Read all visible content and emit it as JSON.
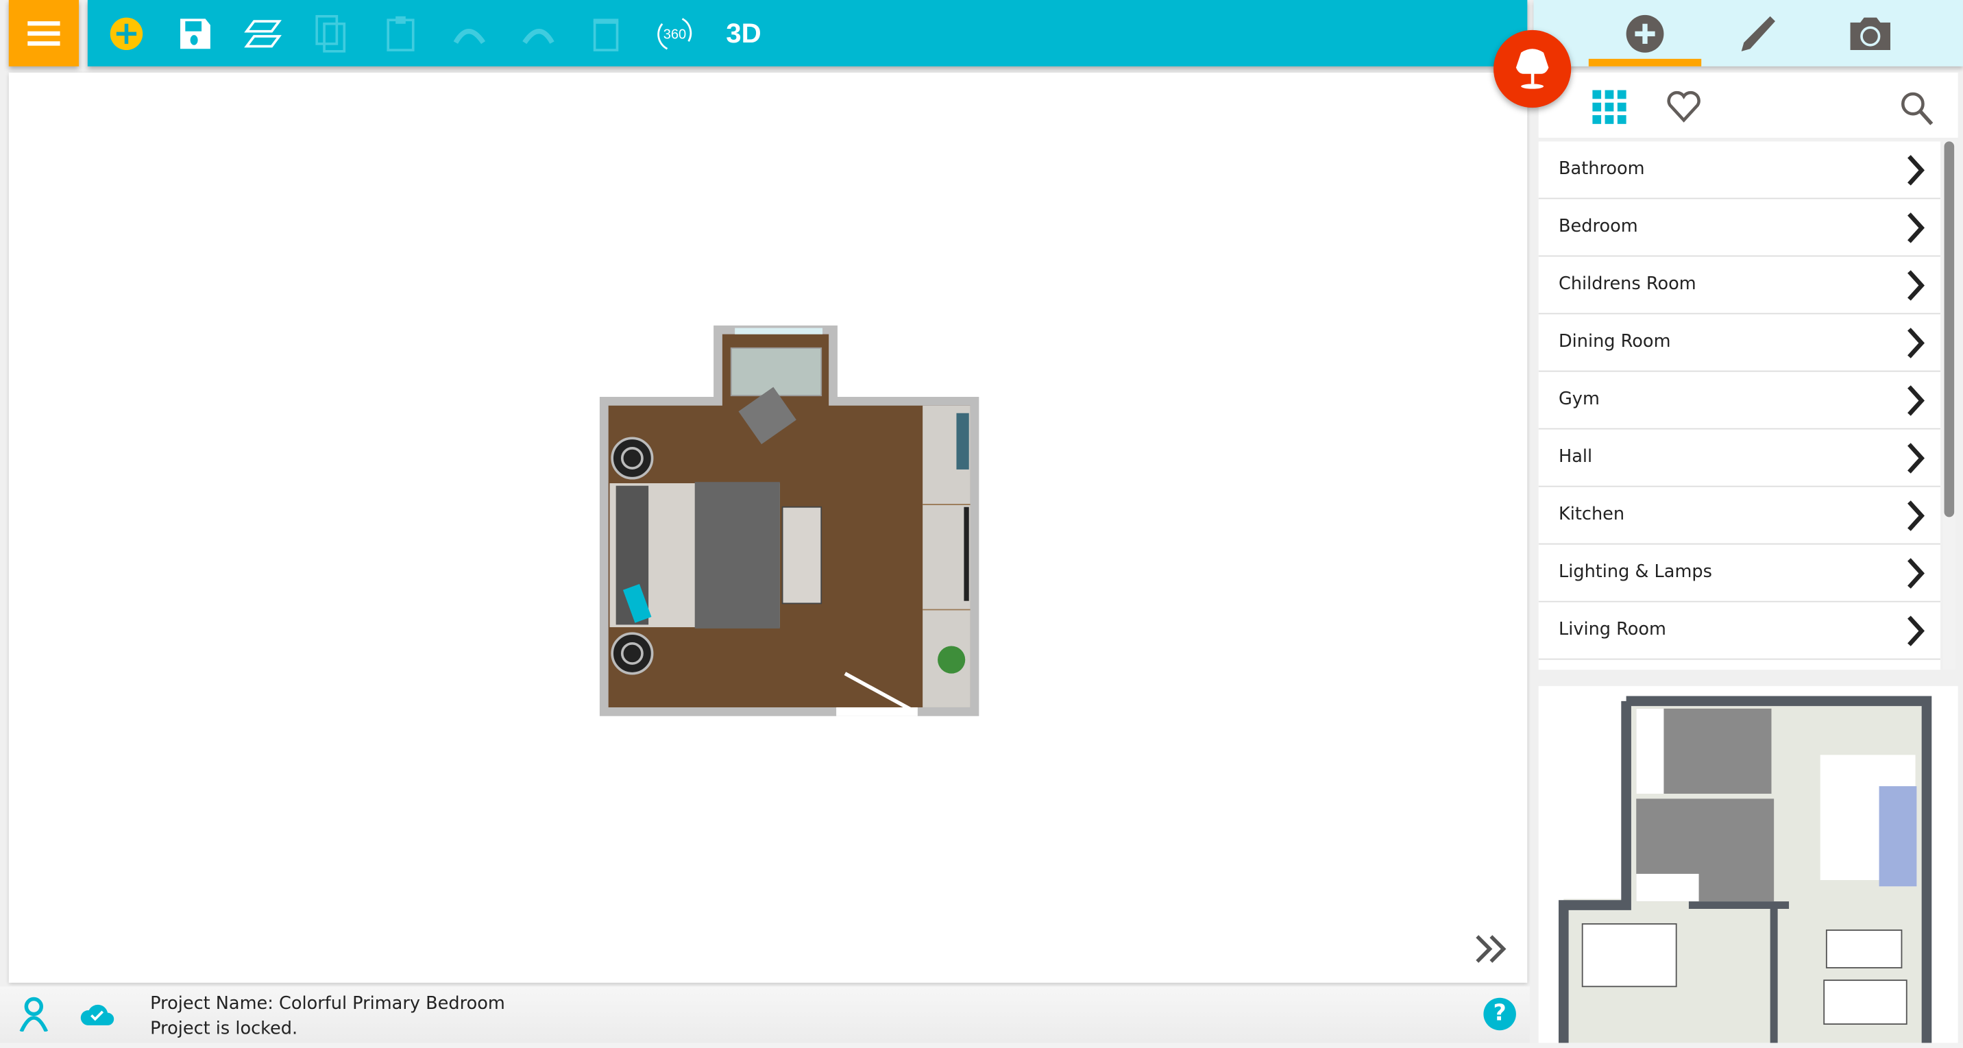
{
  "toolbar": {
    "menu_icon": "hamburger-icon",
    "tools": [
      {
        "name": "add",
        "icon": "plus-circle-icon",
        "enabled": true
      },
      {
        "name": "save",
        "icon": "save-icon",
        "enabled": true
      },
      {
        "name": "floors",
        "icon": "layers-icon",
        "enabled": true
      },
      {
        "name": "copy",
        "icon": "copy-icon",
        "enabled": false
      },
      {
        "name": "paste",
        "icon": "clipboard-icon",
        "enabled": false
      },
      {
        "name": "undo",
        "icon": "undo-icon",
        "enabled": false
      },
      {
        "name": "redo",
        "icon": "redo-icon",
        "enabled": false
      },
      {
        "name": "delete",
        "icon": "trash-icon",
        "enabled": false
      },
      {
        "name": "360",
        "icon": "rotate-360-icon",
        "enabled": true,
        "label": "360"
      },
      {
        "name": "3d",
        "icon": "3d-icon",
        "enabled": true,
        "label": "3D"
      }
    ],
    "color": "#00b8d1",
    "menu_color": "#ffa400"
  },
  "right_panel": {
    "tabs": [
      {
        "icon": "plus-circle-icon",
        "active": true
      },
      {
        "icon": "pencil-icon",
        "active": false
      },
      {
        "icon": "camera-icon",
        "active": false
      }
    ],
    "furniture_button_icon": "chair-icon",
    "subbar": {
      "grid_icon": "grid-icon",
      "favorites_icon": "heart-icon",
      "search_icon": "search-icon"
    },
    "categories": [
      "Bathroom",
      "Bedroom",
      "Childrens Room",
      "Dining Room",
      "Gym",
      "Hall",
      "Kitchen",
      "Lighting & Lamps",
      "Living Room"
    ],
    "accent": "#ffa400",
    "furniture_color": "#ee3300"
  },
  "footer": {
    "project_name": "Project Name: Colorful Primary Bedroom",
    "status": "Project is locked.",
    "user_icon": "user-icon",
    "cloud_icon": "cloud-check-icon",
    "help_icon": "help-icon",
    "help_label": "?"
  },
  "canvas": {
    "expand_icon": "double-chevron-right-icon"
  }
}
